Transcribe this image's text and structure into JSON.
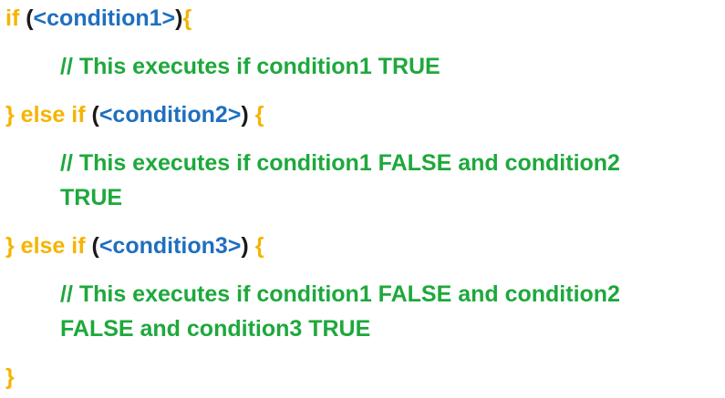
{
  "lines": [
    {
      "keyword": "if ",
      "open_paren": "(",
      "condition": "<condition1>",
      "close_paren": ")",
      "brace": "{"
    },
    {
      "comment": "// This executes if condition1 TRUE"
    },
    {
      "close_brace": "}",
      "keyword": " else if ",
      "open_paren": "(",
      "condition": "<condition2>",
      "close_paren": ")",
      "brace": " {"
    },
    {
      "comment_line1": "// This executes if condition1 FALSE and condition2",
      "comment_line2": "TRUE"
    },
    {
      "close_brace": "}",
      "keyword": " else if ",
      "open_paren": "(",
      "condition": "<condition3>",
      "close_paren": ")",
      "brace": " {"
    },
    {
      "comment_line1": "// This executes if condition1 FALSE and condition2",
      "comment_line2": "FALSE and condition3 TRUE"
    },
    {
      "close_brace": "}"
    }
  ],
  "colors": {
    "keyword": "#f5b400",
    "condition": "#1f6fbf",
    "comment": "#1ea83c",
    "paren": "#1a1a1a"
  }
}
